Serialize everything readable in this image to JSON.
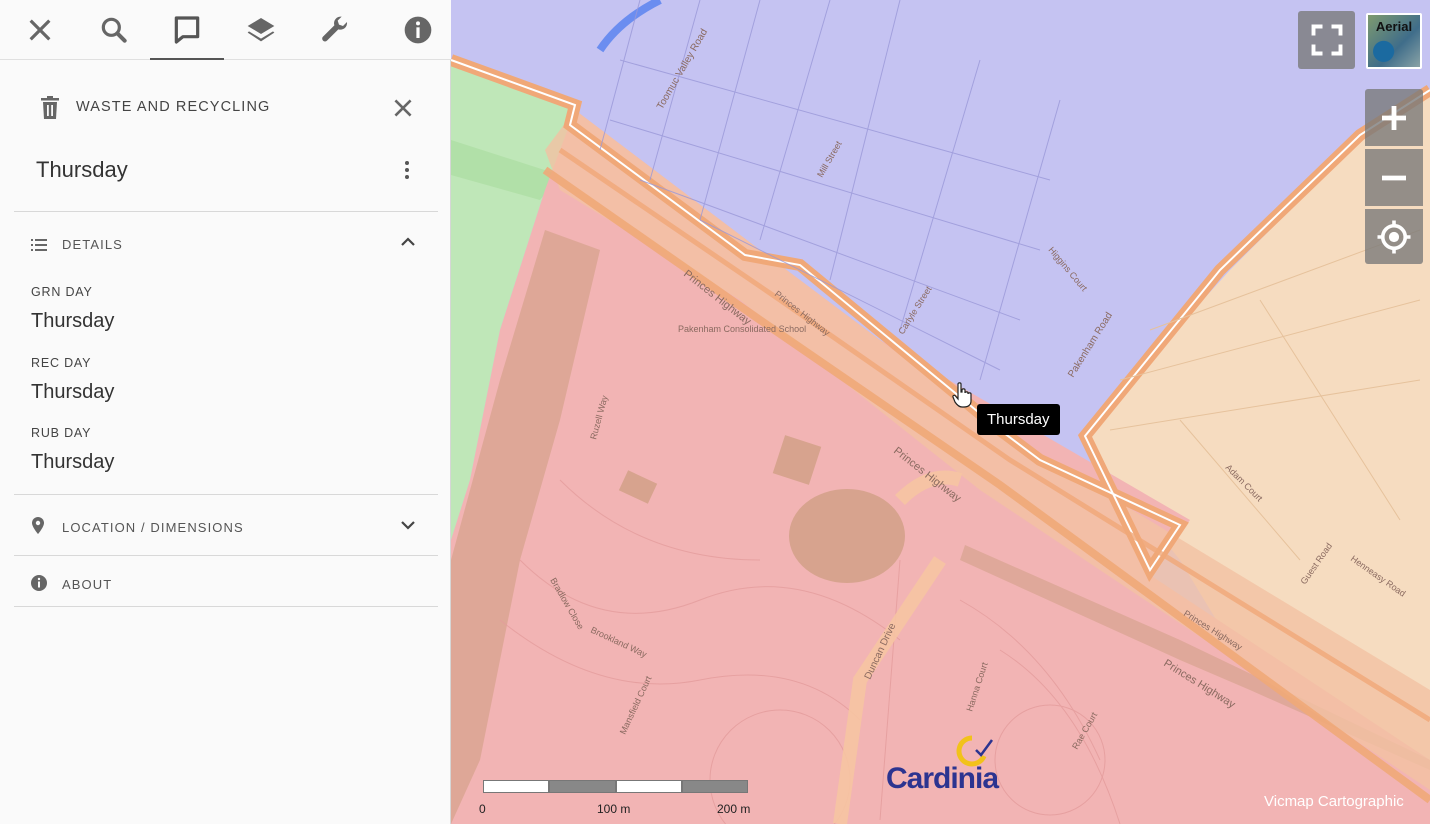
{
  "toolbar": {
    "icons": [
      "close-icon",
      "search-icon",
      "feature-info-icon",
      "layers-icon",
      "tools-icon",
      "info-icon"
    ],
    "active": "feature-info-icon"
  },
  "panel": {
    "layer_title": "WASTE AND RECYCLING",
    "feature_name": "Thursday",
    "details": {
      "header": "DETAILS",
      "fields": [
        {
          "label": "GRN DAY",
          "value": "Thursday"
        },
        {
          "label": "REC DAY",
          "value": "Thursday"
        },
        {
          "label": "RUB DAY",
          "value": "Thursday"
        }
      ]
    },
    "location_header": "LOCATION / DIMENSIONS",
    "about_header": "ABOUT"
  },
  "map": {
    "tooltip": "Thursday",
    "aerial_label": "Aerial",
    "scale": {
      "labels": [
        "0",
        "100 m",
        "200 m"
      ]
    },
    "attribution": "Vicmap Cartographic",
    "logo_text": "Cardinia",
    "street_labels": [
      "Toomuc Valley Road",
      "Mill Street",
      "Princes Highway",
      "Princes Highway",
      "Princes Highway",
      "Princes Highway",
      "Princes Highway",
      "Pakenham Road",
      "Carlyle Street",
      "Higgins Court",
      "Duncan Drive",
      "Ruzell Way",
      "Bradlow Close",
      "Brookland Way",
      "Mansfield Court",
      "Adam Court",
      "Guest Road",
      "Henneasy Road",
      "Hanna Court",
      "Rae Court",
      "Pakenham Consolidated School"
    ],
    "colors": {
      "residential": "#c5c3f2",
      "industrial": "#f2b4b4",
      "rural": "#f6dcc0",
      "park": "#bfe7b8",
      "road_outline": "#f0a878"
    }
  }
}
